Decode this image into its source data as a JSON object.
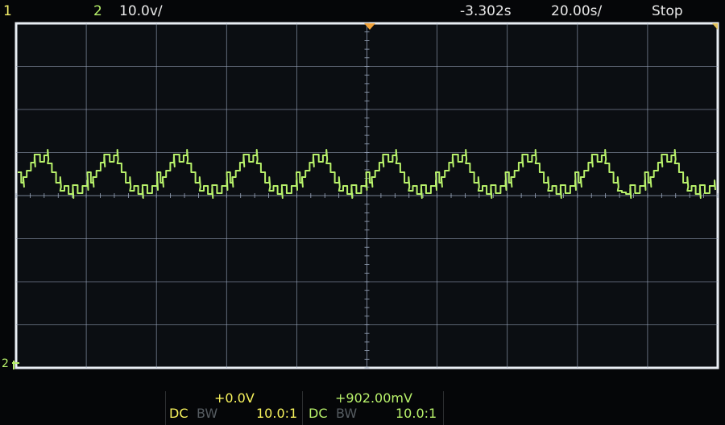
{
  "header": {
    "channel1_label": "1",
    "channel2_label": "2",
    "volts_per_div": "10.0v/",
    "trigger_offset": "-3.302s",
    "time_per_div": "20.00s/",
    "run_state": "Stop"
  },
  "markers": {
    "ch2_ground_marker": "2"
  },
  "channels": [
    {
      "coupling": "DC",
      "bw": "BW",
      "offset": "+0.0V",
      "probe": "10.0:1"
    },
    {
      "coupling": "DC",
      "bw": "BW",
      "offset": "+902.00mV",
      "probe": "10.0:1"
    }
  ],
  "colors": {
    "grid": "#9aa7bd",
    "border": "#e9eef4",
    "trace": "#b7f06a",
    "channel1": "#f7f25c",
    "channel2": "#b7f06a",
    "trigger_marker": "#f2a33a"
  },
  "waveform": {
    "type": "stepped-periodic",
    "cycles_visible": 10,
    "state": "stopped"
  }
}
